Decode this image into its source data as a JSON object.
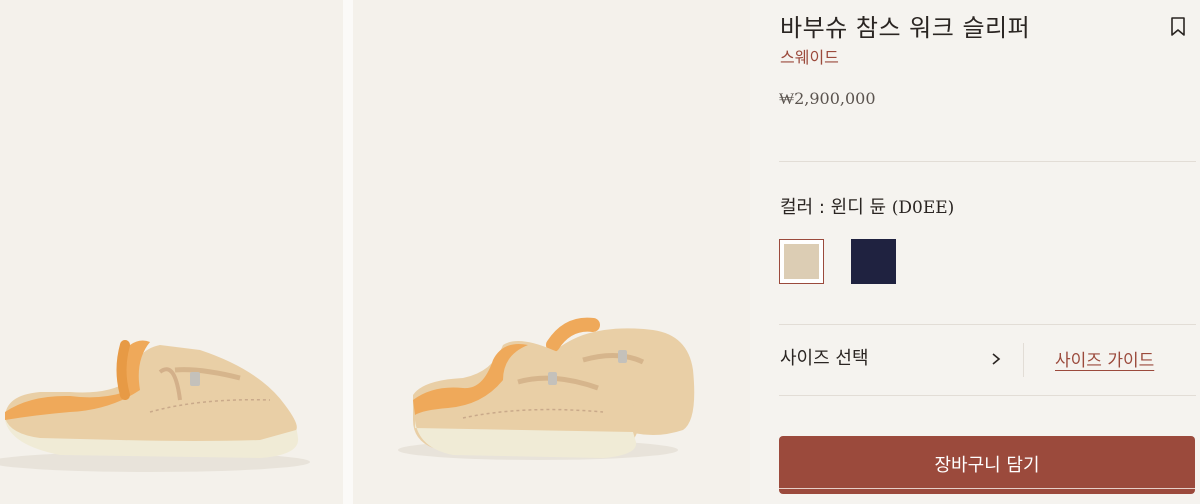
{
  "product": {
    "title": "바부슈 참스 워크 슬리퍼",
    "material": "스웨이드",
    "price": "₩2,900,000"
  },
  "color": {
    "label_prefix": "컬러 : ",
    "selected_name": "윈디 듄",
    "selected_code": "(D0EE)",
    "swatches": [
      {
        "name": "windy-dune",
        "hex": "#dccdb4",
        "selected": true
      },
      {
        "name": "navy",
        "hex": "#1f2240",
        "selected": false
      }
    ]
  },
  "size": {
    "select_label": "사이즈 선택",
    "guide_label": "사이즈 가이드"
  },
  "cart": {
    "button_label": "장바구니 담기"
  },
  "colors": {
    "accent": "#9b4a3c",
    "background": "#f5f3ef",
    "gallery_background": "#f4f1eb"
  },
  "icons": {
    "bookmark": "bookmark-icon",
    "chevron": "chevron-right-icon"
  }
}
